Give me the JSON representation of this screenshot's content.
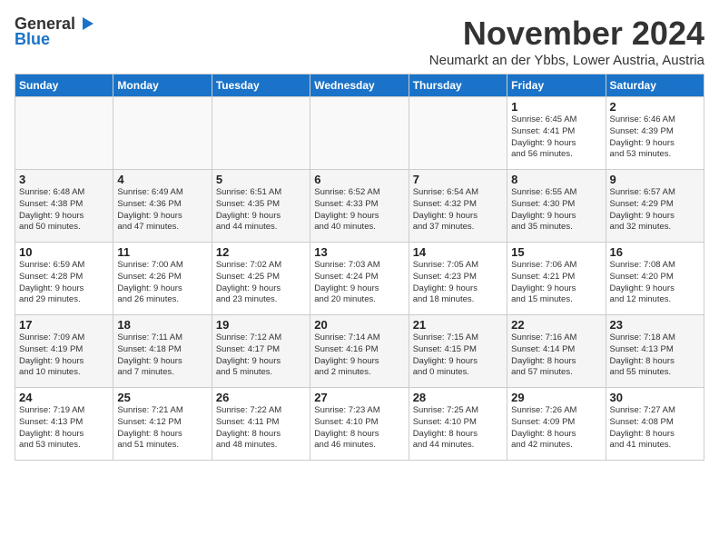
{
  "logo": {
    "line1": "General",
    "line2": "Blue"
  },
  "header": {
    "title": "November 2024",
    "subtitle": "Neumarkt an der Ybbs, Lower Austria, Austria"
  },
  "weekdays": [
    "Sunday",
    "Monday",
    "Tuesday",
    "Wednesday",
    "Thursday",
    "Friday",
    "Saturday"
  ],
  "weeks": [
    [
      {
        "day": "",
        "info": ""
      },
      {
        "day": "",
        "info": ""
      },
      {
        "day": "",
        "info": ""
      },
      {
        "day": "",
        "info": ""
      },
      {
        "day": "",
        "info": ""
      },
      {
        "day": "1",
        "info": "Sunrise: 6:45 AM\nSunset: 4:41 PM\nDaylight: 9 hours\nand 56 minutes."
      },
      {
        "day": "2",
        "info": "Sunrise: 6:46 AM\nSunset: 4:39 PM\nDaylight: 9 hours\nand 53 minutes."
      }
    ],
    [
      {
        "day": "3",
        "info": "Sunrise: 6:48 AM\nSunset: 4:38 PM\nDaylight: 9 hours\nand 50 minutes."
      },
      {
        "day": "4",
        "info": "Sunrise: 6:49 AM\nSunset: 4:36 PM\nDaylight: 9 hours\nand 47 minutes."
      },
      {
        "day": "5",
        "info": "Sunrise: 6:51 AM\nSunset: 4:35 PM\nDaylight: 9 hours\nand 44 minutes."
      },
      {
        "day": "6",
        "info": "Sunrise: 6:52 AM\nSunset: 4:33 PM\nDaylight: 9 hours\nand 40 minutes."
      },
      {
        "day": "7",
        "info": "Sunrise: 6:54 AM\nSunset: 4:32 PM\nDaylight: 9 hours\nand 37 minutes."
      },
      {
        "day": "8",
        "info": "Sunrise: 6:55 AM\nSunset: 4:30 PM\nDaylight: 9 hours\nand 35 minutes."
      },
      {
        "day": "9",
        "info": "Sunrise: 6:57 AM\nSunset: 4:29 PM\nDaylight: 9 hours\nand 32 minutes."
      }
    ],
    [
      {
        "day": "10",
        "info": "Sunrise: 6:59 AM\nSunset: 4:28 PM\nDaylight: 9 hours\nand 29 minutes."
      },
      {
        "day": "11",
        "info": "Sunrise: 7:00 AM\nSunset: 4:26 PM\nDaylight: 9 hours\nand 26 minutes."
      },
      {
        "day": "12",
        "info": "Sunrise: 7:02 AM\nSunset: 4:25 PM\nDaylight: 9 hours\nand 23 minutes."
      },
      {
        "day": "13",
        "info": "Sunrise: 7:03 AM\nSunset: 4:24 PM\nDaylight: 9 hours\nand 20 minutes."
      },
      {
        "day": "14",
        "info": "Sunrise: 7:05 AM\nSunset: 4:23 PM\nDaylight: 9 hours\nand 18 minutes."
      },
      {
        "day": "15",
        "info": "Sunrise: 7:06 AM\nSunset: 4:21 PM\nDaylight: 9 hours\nand 15 minutes."
      },
      {
        "day": "16",
        "info": "Sunrise: 7:08 AM\nSunset: 4:20 PM\nDaylight: 9 hours\nand 12 minutes."
      }
    ],
    [
      {
        "day": "17",
        "info": "Sunrise: 7:09 AM\nSunset: 4:19 PM\nDaylight: 9 hours\nand 10 minutes."
      },
      {
        "day": "18",
        "info": "Sunrise: 7:11 AM\nSunset: 4:18 PM\nDaylight: 9 hours\nand 7 minutes."
      },
      {
        "day": "19",
        "info": "Sunrise: 7:12 AM\nSunset: 4:17 PM\nDaylight: 9 hours\nand 5 minutes."
      },
      {
        "day": "20",
        "info": "Sunrise: 7:14 AM\nSunset: 4:16 PM\nDaylight: 9 hours\nand 2 minutes."
      },
      {
        "day": "21",
        "info": "Sunrise: 7:15 AM\nSunset: 4:15 PM\nDaylight: 9 hours\nand 0 minutes."
      },
      {
        "day": "22",
        "info": "Sunrise: 7:16 AM\nSunset: 4:14 PM\nDaylight: 8 hours\nand 57 minutes."
      },
      {
        "day": "23",
        "info": "Sunrise: 7:18 AM\nSunset: 4:13 PM\nDaylight: 8 hours\nand 55 minutes."
      }
    ],
    [
      {
        "day": "24",
        "info": "Sunrise: 7:19 AM\nSunset: 4:13 PM\nDaylight: 8 hours\nand 53 minutes."
      },
      {
        "day": "25",
        "info": "Sunrise: 7:21 AM\nSunset: 4:12 PM\nDaylight: 8 hours\nand 51 minutes."
      },
      {
        "day": "26",
        "info": "Sunrise: 7:22 AM\nSunset: 4:11 PM\nDaylight: 8 hours\nand 48 minutes."
      },
      {
        "day": "27",
        "info": "Sunrise: 7:23 AM\nSunset: 4:10 PM\nDaylight: 8 hours\nand 46 minutes."
      },
      {
        "day": "28",
        "info": "Sunrise: 7:25 AM\nSunset: 4:10 PM\nDaylight: 8 hours\nand 44 minutes."
      },
      {
        "day": "29",
        "info": "Sunrise: 7:26 AM\nSunset: 4:09 PM\nDaylight: 8 hours\nand 42 minutes."
      },
      {
        "day": "30",
        "info": "Sunrise: 7:27 AM\nSunset: 4:08 PM\nDaylight: 8 hours\nand 41 minutes."
      }
    ]
  ]
}
